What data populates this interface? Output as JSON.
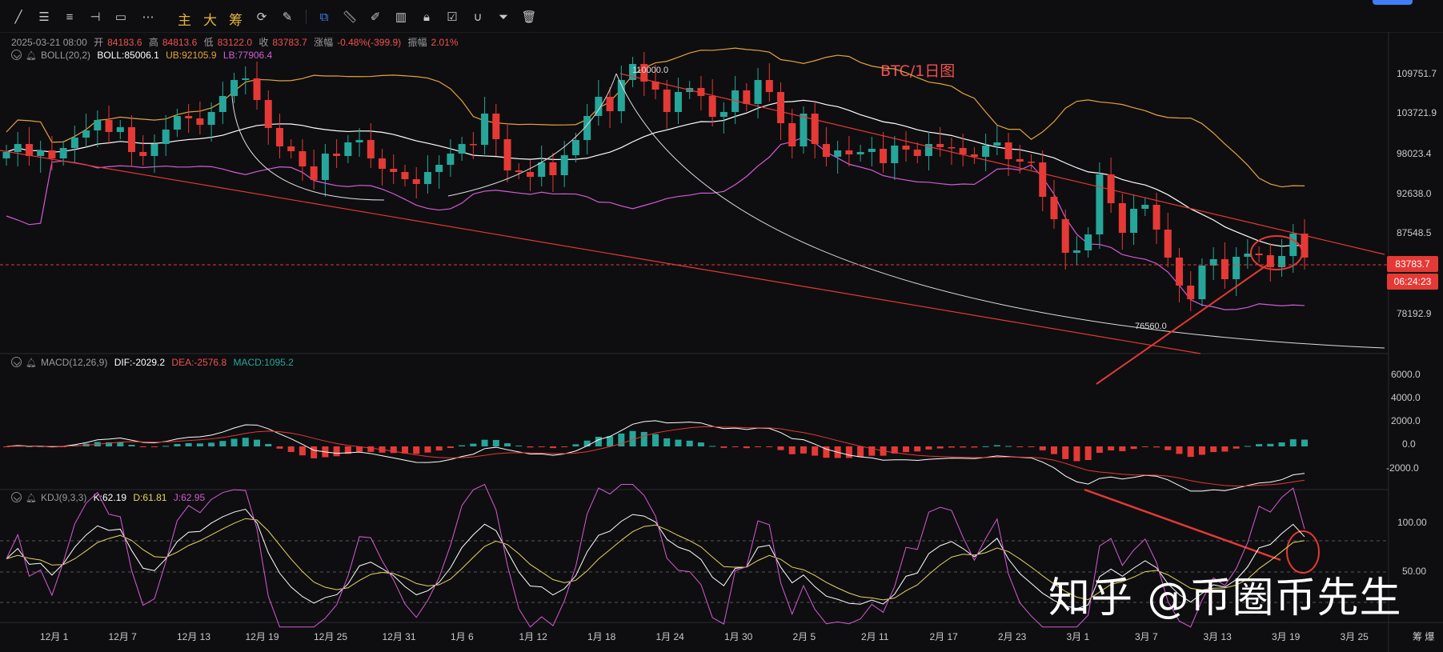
{
  "toolbar": {
    "tools": [
      "trend-line-icon",
      "horizontal-lines-icon",
      "parallel-channel-icon",
      "horizontal-ray-icon",
      "rectangle-icon",
      "more-tools-icon"
    ],
    "text_tools": [
      "主",
      "大",
      "筹"
    ],
    "right_tools": [
      "annotate-icon",
      "ruler-icon",
      "brush-icon",
      "layout-icon",
      "lock-icon",
      "note-icon",
      "magnet-icon",
      "filter-icon",
      "trash-icon"
    ]
  },
  "legend_main": {
    "datetime": "2025-03-21 08:00",
    "open_label": "开",
    "open": "84183.6",
    "high_label": "高",
    "high": "84813.6",
    "low_label": "低",
    "low": "83122.0",
    "close_label": "收",
    "close": "83783.7",
    "change_label": "涨幅",
    "change": "-0.48%(-399.9)",
    "amp_label": "振幅",
    "amp": "2.01%"
  },
  "legend_boll": {
    "name": "BOLL(20,2)",
    "mid": "BOLL:85006.1",
    "ub": "UB:92105.9",
    "lb": "LB:77906.4"
  },
  "legend_macd": {
    "name": "MACD(12,26,9)",
    "dif": "DIF:-2029.2",
    "dea": "DEA:-2576.8",
    "macd": "MACD:1095.2"
  },
  "legend_kdj": {
    "name": "KDJ(9,3,3)",
    "k": "K:62.19",
    "d": "D:61.81",
    "j": "J:62.95"
  },
  "annotation": "BTC/1日图",
  "watermark": "知乎 @币圈币先生",
  "price_axis": [
    "109751.7",
    "103721.9",
    "98023.4",
    "92638.0",
    "87548.5",
    "78192.9"
  ],
  "current_price": "83783.7",
  "countdown": "06:24:23",
  "high_mark": "110000.0",
  "low_mark": "76560.0",
  "macd_axis": [
    "6000.0",
    "4000.0",
    "2000.0",
    "0.0",
    "-2000.0"
  ],
  "kdj_axis": [
    "100.00",
    "50.00"
  ],
  "x_axis": [
    "12月 1",
    "12月 7",
    "12月 13",
    "12月 19",
    "12月 25",
    "12月 31",
    "1月 6",
    "1月 12",
    "1月 18",
    "1月 24",
    "1月 30",
    "2月 5",
    "2月 11",
    "2月 17",
    "2月 23",
    "3月 1",
    "3月 7",
    "3月 13",
    "3月 19",
    "3月 25"
  ],
  "corner_label": "筹 爆",
  "colors": {
    "up": "#26a69a",
    "down": "#e53935",
    "boll_mid": "#ffffff",
    "boll_ub": "#e3a33c",
    "boll_lb": "#d45bd4",
    "accent": "#3f7ef6"
  },
  "chart_data": {
    "type": "candlestick",
    "title": "BTC/1日图",
    "x_start": "2024-11-27",
    "x_end": "2025-03-21",
    "ylim": [
      72000,
      112000
    ],
    "closes": [
      97000,
      98000,
      96500,
      97200,
      96200,
      97500,
      98800,
      99700,
      101000,
      99500,
      100100,
      97000,
      96500,
      98000,
      99800,
      101500,
      101200,
      100400,
      102000,
      104000,
      106000,
      106200,
      103500,
      100000,
      97700,
      97100,
      95200,
      93500,
      96800,
      96500,
      98200,
      98500,
      96200,
      94900,
      94500,
      93600,
      93000,
      94500,
      95400,
      96800,
      98000,
      97900,
      101800,
      98600,
      94700,
      94500,
      93900,
      95700,
      94100,
      96600,
      98500,
      101500,
      103900,
      102100,
      106000,
      108000,
      105800,
      104800,
      102000,
      104500,
      105000,
      104000,
      101400,
      102000,
      104700,
      103000,
      106000,
      104500,
      100600,
      97700,
      101800,
      98000,
      96400,
      97200,
      96700,
      97000,
      97400,
      95600,
      97800,
      97300,
      96500,
      98000,
      97600,
      97500,
      96700,
      96400,
      97800,
      98200,
      96100,
      95800,
      95700,
      91400,
      88600,
      84400,
      84700,
      86700,
      94200,
      90600,
      86900,
      89900,
      90400,
      87300,
      83800,
      80300,
      78600,
      82800,
      83600,
      81100,
      83900,
      84300,
      84100,
      82600,
      84000,
      86800,
      83800
    ],
    "series": [
      {
        "name": "BOLL",
        "values": [
          85006.1
        ]
      },
      {
        "name": "UB",
        "values": [
          92105.9
        ]
      },
      {
        "name": "LB",
        "values": [
          77906.4
        ]
      }
    ],
    "macd": {
      "DIF": -2029.2,
      "DEA": -2576.8,
      "MACD": 1095.2,
      "ylim": [
        -3000,
        7000
      ]
    },
    "kdj": {
      "K": 62.19,
      "D": 61.81,
      "J": 62.95,
      "ylim": [
        0,
        110
      ]
    },
    "annotations": [
      {
        "text": "110000.0",
        "type": "high"
      },
      {
        "text": "76560.0",
        "type": "low"
      }
    ]
  }
}
